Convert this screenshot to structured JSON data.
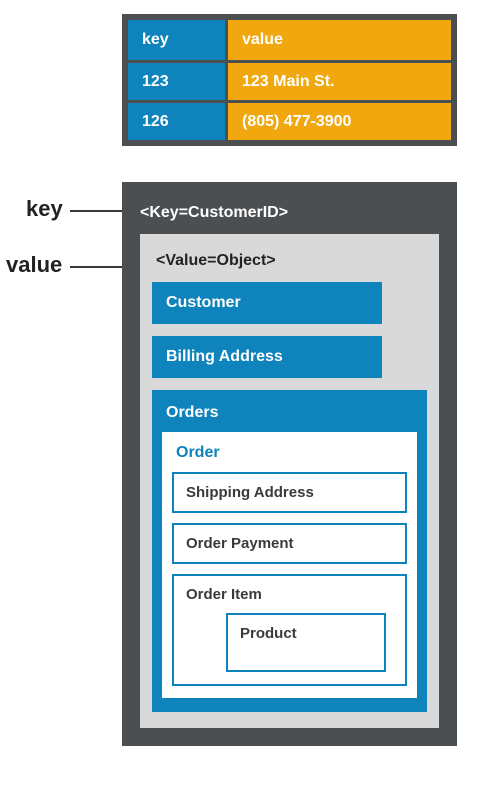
{
  "kvTable": {
    "header": {
      "key": "key",
      "value": "value"
    },
    "rows": [
      {
        "key": "123",
        "value": "123 Main St."
      },
      {
        "key": "126",
        "value": "(805) 477-3900"
      }
    ]
  },
  "labels": {
    "key": "key",
    "value": "value"
  },
  "object": {
    "keyLabel": "<Key=CustomerID>",
    "valueLabel": "<Value=Object>",
    "customer": "Customer",
    "billing": "Billing Address",
    "orders": {
      "title": "Orders",
      "order": {
        "title": "Order",
        "shipping": "Shipping Address",
        "payment": "Order Payment",
        "item": {
          "title": "Order Item",
          "product": "Product"
        }
      }
    }
  }
}
